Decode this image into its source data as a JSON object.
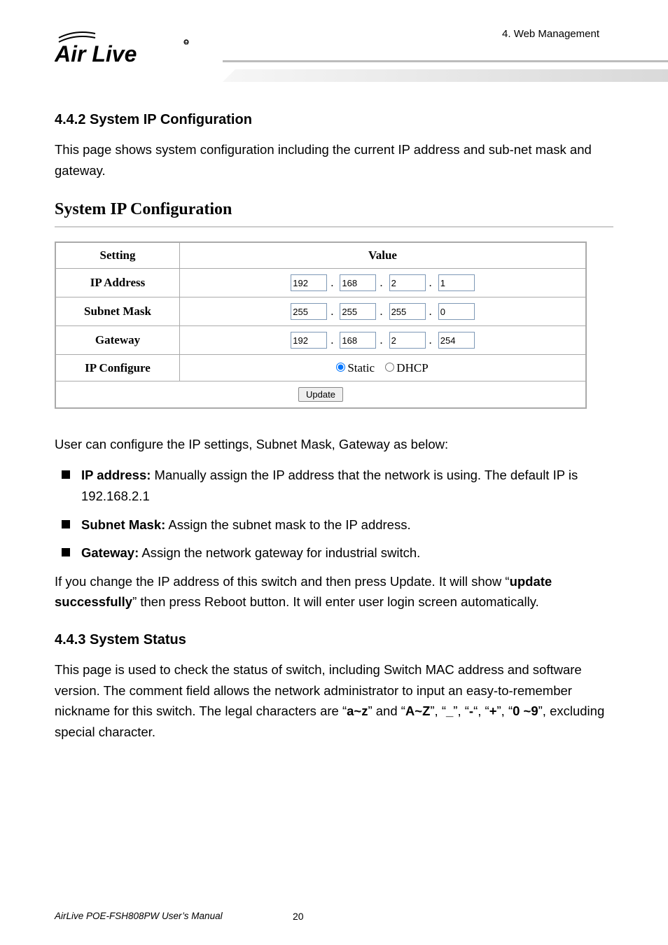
{
  "header": {
    "breadcrumb": "4.  Web  Management",
    "brand_alt": "Air Live"
  },
  "section1": {
    "heading": "4.4.2 System IP Configuration",
    "intro": "This page shows system configuration including the current IP address and sub-net mask and gateway."
  },
  "figure": {
    "title": "System IP Configuration",
    "col_setting": "Setting",
    "col_value": "Value",
    "row_ip_label": "IP Address",
    "row_subnet_label": "Subnet Mask",
    "row_gateway_label": "Gateway",
    "row_configure_label": "IP Configure",
    "ip": [
      "192",
      "168",
      "2",
      "1"
    ],
    "subnet": [
      "255",
      "255",
      "255",
      "0"
    ],
    "gateway": [
      "192",
      "168",
      "2",
      "254"
    ],
    "radio_static": "Static",
    "radio_dhcp": "DHCP",
    "update_btn": "Update"
  },
  "afterfig": {
    "lead": "User can configure the IP settings, Subnet Mask, Gateway as below:",
    "bullets": [
      {
        "b": "IP address:",
        "t": " Manually assign the IP address that the network is using. The default IP is 192.168.2.1"
      },
      {
        "b": "Subnet Mask:",
        "t": " Assign the subnet mask to the IP address."
      },
      {
        "b": "Gateway:",
        "t": " Assign the network gateway for industrial switch."
      }
    ],
    "note_pre": "If you change the IP address of this switch and then press Update. It will show “",
    "note_bold": "update successfully",
    "note_post": "” then press Reboot button. It will enter user login screen automatically."
  },
  "section2": {
    "heading": "4.4.3 System Status",
    "p_pre": "This page is used to check the status of switch, including Switch MAC address and software version. The comment field allows the network administrator to input an easy-to-remember nickname for this switch. The legal characters are “",
    "b1": "a~z",
    "mid1": "” and “",
    "b2": "A~Z",
    "mid2": "”, “",
    "b3": "_",
    "mid3": "”, “",
    "b4": "-",
    "mid4": "“, “",
    "b5": "+",
    "mid5": "”, “",
    "b6": "0 ~9",
    "post": "”, excluding special character."
  },
  "footer": {
    "left": "AirLive POE-FSH808PW User’s Manual",
    "page": "20"
  }
}
